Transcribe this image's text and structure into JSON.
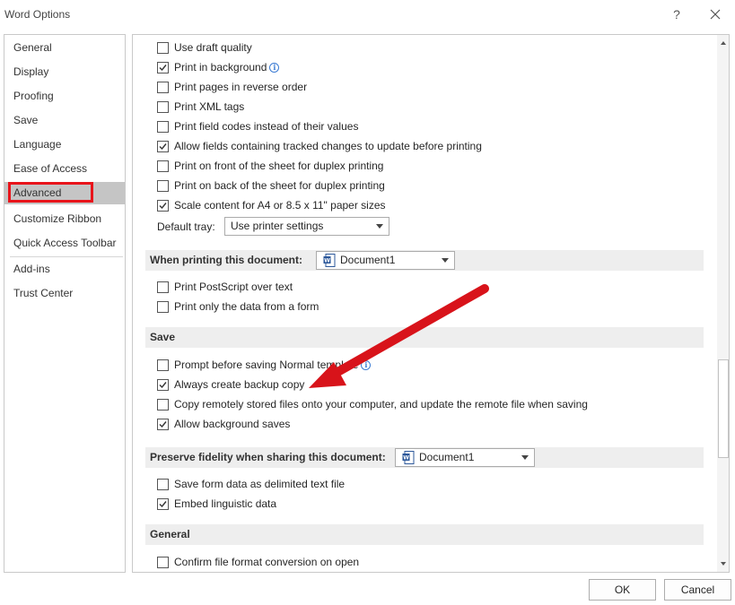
{
  "window": {
    "title": "Word Options",
    "help": "?"
  },
  "sidebar": {
    "items": [
      {
        "label": "General"
      },
      {
        "label": "Display"
      },
      {
        "label": "Proofing"
      },
      {
        "label": "Save"
      },
      {
        "label": "Language"
      },
      {
        "label": "Ease of Access"
      },
      {
        "label": "Advanced",
        "selected": true
      },
      {
        "label": "Customize Ribbon"
      },
      {
        "label": "Quick Access Toolbar"
      },
      {
        "label": "Add-ins"
      },
      {
        "label": "Trust Center"
      }
    ]
  },
  "print_options": [
    {
      "label": "Use draft quality",
      "checked": false
    },
    {
      "label": "Print in background",
      "checked": true,
      "info": true
    },
    {
      "label": "Print pages in reverse order",
      "checked": false
    },
    {
      "label": "Print XML tags",
      "checked": false
    },
    {
      "label": "Print field codes instead of their values",
      "checked": false
    },
    {
      "label": "Allow fields containing tracked changes to update before printing",
      "checked": true
    },
    {
      "label": "Print on front of the sheet for duplex printing",
      "checked": false
    },
    {
      "label": "Print on back of the sheet for duplex printing",
      "checked": false
    },
    {
      "label": "Scale content for A4 or 8.5 x 11\" paper sizes",
      "checked": true
    }
  ],
  "default_tray": {
    "label": "Default tray:",
    "value": "Use printer settings"
  },
  "when_printing": {
    "title": "When printing this document:",
    "document": "Document1",
    "options": [
      {
        "label": "Print PostScript over text",
        "checked": false
      },
      {
        "label": "Print only the data from a form",
        "checked": false
      }
    ]
  },
  "save_section": {
    "title": "Save",
    "options": [
      {
        "label": "Prompt before saving Normal template",
        "checked": false,
        "info": true
      },
      {
        "label": "Always create backup copy",
        "checked": true
      },
      {
        "label": "Copy remotely stored files onto your computer, and update the remote file when saving",
        "checked": false
      },
      {
        "label": "Allow background saves",
        "checked": true
      }
    ]
  },
  "preserve_fidelity": {
    "title": "Preserve fidelity when sharing this document:",
    "document": "Document1",
    "options": [
      {
        "label": "Save form data as delimited text file",
        "checked": false
      },
      {
        "label": "Embed linguistic data",
        "checked": true
      }
    ]
  },
  "general_section": {
    "title": "General",
    "options": [
      {
        "label": "Confirm file format conversion on open",
        "checked": false
      }
    ]
  },
  "buttons": {
    "ok": "OK",
    "cancel": "Cancel"
  },
  "colors": {
    "highlight_red": "#e8141b",
    "selected_nav": "#c5c5c5",
    "section_bg": "#eeeeee"
  }
}
